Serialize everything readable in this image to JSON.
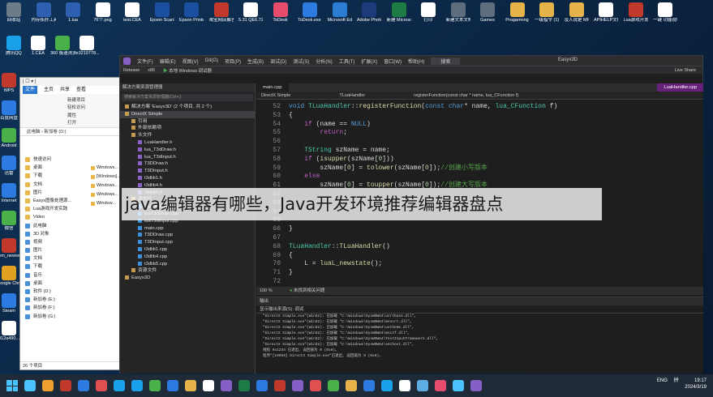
{
  "desktop": {
    "row1": [
      {
        "label": "回收站",
        "color": "#6d7a88"
      },
      {
        "label": "内存拓扑工具.LUA",
        "color": "#2f5fb0"
      },
      {
        "label": "1.lua",
        "color": "#2f5fb0"
      },
      {
        "label": "76个.png",
        "color": "#ffffff"
      },
      {
        "label": "test.CEA",
        "color": "#ffffff"
      },
      {
        "label": "Epson ScanSmart",
        "color": "#1b4fa0"
      },
      {
        "label": "Epson Printer C...",
        "color": "#1b4fa0"
      },
      {
        "label": "淘宝网店解答.docx",
        "color": "#c0392b"
      },
      {
        "label": "5.31 QE6.72...",
        "color": "#ffffff"
      },
      {
        "label": "ToDesk",
        "color": "#e74c6c"
      },
      {
        "label": "ToDesk.exe - 快捷方式",
        "color": "#2d7be0"
      },
      {
        "label": "Microsoft Edge",
        "color": "#2b7cd3"
      },
      {
        "label": "Adobe Photosho...",
        "color": "#1d3a7a"
      },
      {
        "label": "新建 Microsoft...",
        "color": "#1e7b45"
      },
      {
        "label": "打印",
        "color": "#ffffff"
      },
      {
        "label": "新建文本文档 (4).zip",
        "color": "#5d6d7e"
      },
      {
        "label": "Games",
        "color": "#5d6d7e"
      },
      {
        "label": "Progarming",
        "color": "#e6b34a"
      },
      {
        "label": "一级指令 (1).hat",
        "color": "#e6b34a"
      },
      {
        "label": "淡入说是 MFC (建)...",
        "color": "#e6b34a"
      },
      {
        "label": "APIHELP文档 一整理...",
        "color": "#ffffff"
      },
      {
        "label": "Lua游戏开发实践.pdf",
        "color": "#c0392b"
      },
      {
        "label": "一键 功能说明",
        "color": "#ffffff"
      }
    ],
    "row2": [
      {
        "label": "腾讯QQ",
        "color": "#1aa0e8"
      },
      {
        "label": "1.CEA",
        "color": "#ffffff"
      },
      {
        "label": "360 极速浏览器",
        "color": "#4ab04a"
      },
      {
        "label": "fe3219778...",
        "color": "#ffffff"
      }
    ],
    "col_left": [
      {
        "label": "WPS",
        "color": "#c0392b"
      },
      {
        "label": "百度网盘",
        "color": "#2d7be0"
      },
      {
        "label": "Android",
        "color": "#4ab04a"
      },
      {
        "label": "迅雷",
        "color": "#2d7be0"
      },
      {
        "label": "Internet",
        "color": "#2d7be0"
      },
      {
        "label": "微信",
        "color": "#4ab04a"
      },
      {
        "label": "rem_newsw",
        "color": "#c0392b"
      },
      {
        "label": "Google Chrome",
        "color": "#e0a020"
      },
      {
        "label": "Steam",
        "color": "#2d7be0"
      },
      {
        "label": "012a490...",
        "color": "#ffffff"
      }
    ]
  },
  "explorer": {
    "title": "| ☐ ▾ |",
    "ribbon": [
      "文件",
      "主页",
      "共享",
      "查看"
    ],
    "tools": [
      "新建项目",
      "轻松访问",
      "属性",
      "打开"
    ],
    "address": "此电脑 › 新加卷 (D:)",
    "nav": [
      "快速访问",
      "桌面",
      "下载",
      "文档",
      "图片",
      "Easyx图像处理源...",
      "Lua游戏开发实践",
      "Video",
      "此电脑",
      "3D 对象",
      "视频",
      "图片",
      "文档",
      "下载",
      "音乐",
      "桌面",
      "软件 (D:)",
      "新加卷 (E:)",
      "新加卷 (F:)",
      "新加卷 (G:)"
    ],
    "files": [
      "Windows...",
      "[Windows]...",
      "Windows...",
      "Windows...",
      "Window..."
    ],
    "status": "26 个项目"
  },
  "vs": {
    "menu": [
      "文件(F)",
      "编辑(E)",
      "视图(V)",
      "Git(G)",
      "项目(P)",
      "生成(B)",
      "调试(D)",
      "测试(S)",
      "分析(N)",
      "工具(T)",
      "扩展(X)",
      "窗口(W)",
      "帮助(H)"
    ],
    "search": "搜索",
    "project_title": "Easyx3D",
    "live_share": "Live Share",
    "toolbar": [
      "Release",
      "x86",
      "本地 Windows 调试器"
    ],
    "solution_header": "解决方案资源管理器",
    "solution_search": "搜索解决方案资源管理器(Ctrl+;)",
    "tree": [
      {
        "text": "解决方案 'Easyx3D' (2 个项目, 共 2 个)",
        "level": 0,
        "type": "f"
      },
      {
        "text": "DirectX Simple",
        "level": 0,
        "type": "f",
        "selected": true
      },
      {
        "text": "引用",
        "level": 1,
        "type": "f"
      },
      {
        "text": "外部依赖项",
        "level": 1,
        "type": "f"
      },
      {
        "text": "头文件",
        "level": 1,
        "type": "f"
      },
      {
        "text": "LuaHandler.h",
        "level": 2,
        "type": "h"
      },
      {
        "text": "lua_T3dDraw.h",
        "level": 2,
        "type": "h"
      },
      {
        "text": "lua_T3dInput.h",
        "level": 2,
        "type": "h"
      },
      {
        "text": "T3DDraw.h",
        "level": 2,
        "type": "h"
      },
      {
        "text": "T3DInput.h",
        "level": 2,
        "type": "h"
      },
      {
        "text": "t3dlib1.h",
        "level": 2,
        "type": "h"
      },
      {
        "text": "t3dlib4.h",
        "level": 2,
        "type": "h"
      },
      {
        "text": "t3dlib5.h",
        "level": 2,
        "type": "h"
      },
      {
        "text": "源文件",
        "level": 1,
        "type": "f"
      },
      {
        "text": "LuaHandler.cpp",
        "level": 2,
        "type": "c"
      },
      {
        "text": "luaT3dDraw.cpp",
        "level": 2,
        "type": "c"
      },
      {
        "text": "luaT3dInput.cpp",
        "level": 2,
        "type": "c"
      },
      {
        "text": "main.cpp",
        "level": 2,
        "type": "c"
      },
      {
        "text": "T3DDraw.cpp",
        "level": 2,
        "type": "c"
      },
      {
        "text": "T3DInput.cpp",
        "level": 2,
        "type": "c"
      },
      {
        "text": "t3dlib1.cpp",
        "level": 2,
        "type": "c"
      },
      {
        "text": "t3dlib4.cpp",
        "level": 2,
        "type": "c"
      },
      {
        "text": "t3dlib5.cpp",
        "level": 2,
        "type": "c"
      },
      {
        "text": "资源文件",
        "level": 1,
        "type": "f"
      },
      {
        "text": "Easyx3D",
        "level": 0,
        "type": "f"
      }
    ],
    "tab_active": "main.cpp",
    "tab_right": "LuaHandler.cpp",
    "nav": [
      "DirectX Simple",
      "TLuaHandler",
      "registerFunction(const char * name, lua_CFunction f)"
    ],
    "line_numbers": [
      "52",
      "53",
      "54",
      "55",
      "56",
      "57",
      "58",
      "59",
      "60",
      "61",
      "62",
      "63",
      "64",
      "65",
      "66",
      "67",
      "68",
      "69",
      "70",
      "71",
      "72",
      "73"
    ],
    "zoom_status": "未找到相关问题",
    "zoom": "100 %",
    "output_header": "输出",
    "output_source": "显示输出来源(S): 调试",
    "output_lines": [
      "\"DirectX Simple.exe\"(Win32): 已加载 \"C:\\Windows\\SysWOW64\\ucrtbase.dll\"。",
      "\"DirectX Simple.exe\"(Win32): 已加载 \"C:\\Windows\\SysWOW64\\msvcrt.dll\"。",
      "\"DirectX Simple.exe\"(Win32): 已加载 \"C:\\Windows\\SysWOW64\\uxtheme.dll\"。",
      "\"DirectX Simple.exe\"(Win32): 已加载 \"C:\\Windows\\SysWOW64\\msctf.dll\"。",
      "\"DirectX Simple.exe\"(Win32): 已加载 \"C:\\Windows\\SysWOW64\\TextInputFramework.dll\"。",
      "\"DirectX Simple.exe\"(Win32): 已加载 \"C:\\Windows\\SysWOW64\\sechost.dll\"。",
      "线程 0x1234 已退出, 返回值为 0 (0x0)。",
      "程序\"[19956] DirectX Simple.exe\"已退出, 返回值为 0 (0x0)。"
    ]
  },
  "caption": "java编辑器有哪些，Java开发环境推荐编辑器盘点",
  "taskbar": {
    "apps": [
      "#4cc2ff",
      "#f0a030",
      "#c0392b",
      "#2d7be0",
      "#e05050",
      "#1aa0e8",
      "#1aa0e8",
      "#4ab04a",
      "#2d7be0",
      "#e6b34a",
      "#ffffff",
      "#865fc5",
      "#1e7b45",
      "#2d7be0",
      "#c0392b",
      "#865fc5",
      "#e05050",
      "#4ab04a",
      "#e6b34a",
      "#2d7be0",
      "#1aa0e8",
      "#ffffff",
      "#5dade2",
      "#e74c6c",
      "#4cc2ff",
      "#865fc5"
    ],
    "lang": "ENG",
    "ime": "拼",
    "time": "19:17",
    "date": "2024/3/19"
  }
}
